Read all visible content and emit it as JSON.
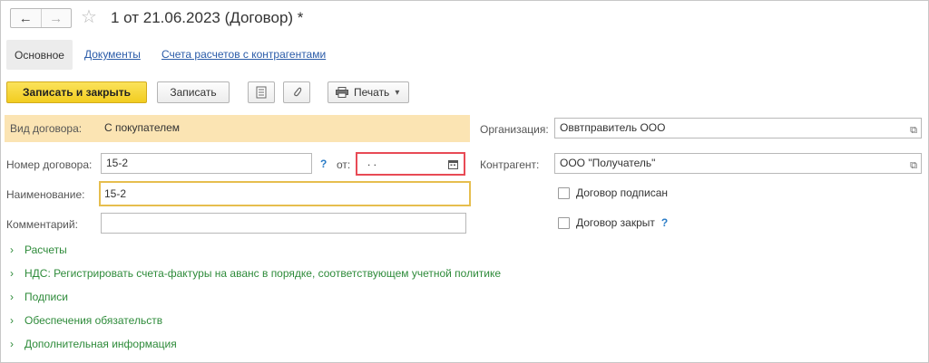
{
  "window": {
    "title": "1 от 21.06.2023 (Договор) *"
  },
  "nav": {
    "back_icon": "←",
    "forward_icon": "→",
    "star_icon": "☆"
  },
  "tabs": [
    "Основное",
    "Документы",
    "Счета расчетов с контрагентами"
  ],
  "toolbar": {
    "save_close_label": "Записать и закрыть",
    "save_label": "Записать",
    "print_label": "Печать",
    "print_dropdown": "▾"
  },
  "form": {
    "contract_type": {
      "label": "Вид договора:",
      "value": "С покупателем"
    },
    "contract_number": {
      "label": "Номер договора:",
      "value": "15-2",
      "help": "?"
    },
    "date": {
      "label": "от:",
      "value": " .  ."
    },
    "name": {
      "label": "Наименование:",
      "value": "15-2"
    },
    "comment": {
      "label": "Комментарий:",
      "value": ""
    },
    "organization": {
      "label": "Организация:",
      "value": "Оввтправитель ООО"
    },
    "counterparty": {
      "label": "Контрагент:",
      "value": "ООО \"Получатель\""
    },
    "signed": {
      "label": "Договор подписан",
      "checked": false
    },
    "closed": {
      "label": "Договор закрыт",
      "checked": false,
      "help": "?"
    }
  },
  "sections": [
    "Расчеты",
    "НДС: Регистрировать счета-фактуры на аванс в порядке, соответствующем учетной политике",
    "Подписи",
    "Обеспечения обязательств",
    "Дополнительная информация"
  ]
}
